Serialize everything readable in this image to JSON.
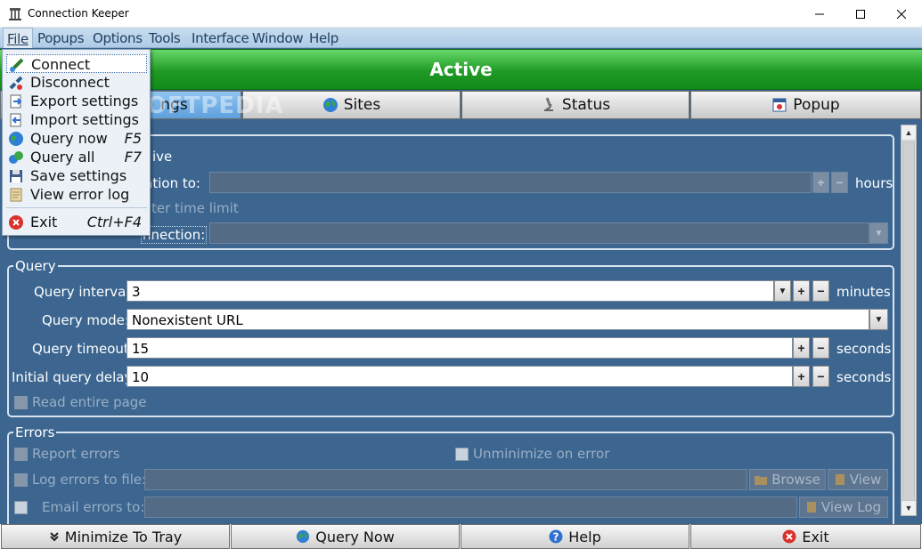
{
  "window": {
    "title": "Connection Keeper",
    "controls": {
      "minimize": "minimize",
      "maximize": "maximize",
      "close": "close"
    }
  },
  "menubar": [
    {
      "label": "File"
    },
    {
      "label": "Popups"
    },
    {
      "label": "Options"
    },
    {
      "label": "Tools"
    },
    {
      "label": "Interface"
    },
    {
      "label": "Window"
    },
    {
      "label": "Help"
    }
  ],
  "status_banner": {
    "text": "Active",
    "color": "#1f9a25"
  },
  "tabs": [
    {
      "label": "ngs",
      "icon": "gear-icon",
      "selected": true
    },
    {
      "label": "Sites",
      "icon": "globe-icon",
      "selected": false
    },
    {
      "label": "Status",
      "icon": "microscope-icon",
      "selected": false
    },
    {
      "label": "Popup",
      "icon": "calendar-icon",
      "selected": false
    }
  ],
  "watermark": "SOFTPEDIA",
  "general": {
    "line1": "ive",
    "duration_label": "ration to:",
    "duration_unit": "hours",
    "after_time_limit": "ter time limit",
    "connection_label": "nnection:"
  },
  "query": {
    "group_title": "Query",
    "interval_label": "Query interval:",
    "interval_value": "3",
    "interval_unit": "minutes",
    "mode_label": "Query mode:",
    "mode_value": "Nonexistent URL",
    "timeout_label": "Query timeout:",
    "timeout_value": "15",
    "timeout_unit": "seconds",
    "delay_label": "Initial query delay:",
    "delay_value": "10",
    "delay_unit": "seconds",
    "read_entire_page": "Read entire page"
  },
  "errors": {
    "group_title": "Errors",
    "report_errors": "Report errors",
    "unminimize_on_error": "Unminimize on error",
    "log_to_file": "Log errors to file:",
    "browse": "Browse",
    "view": "View",
    "email_errors": "Email errors to:",
    "view_log": "View Log"
  },
  "file_menu": [
    {
      "label": "Connect",
      "key": "",
      "icon": "connect-icon",
      "selected": true
    },
    {
      "label": "Disconnect",
      "key": "",
      "icon": "disconnect-icon"
    },
    {
      "label": "Export settings",
      "key": "",
      "icon": "export-icon"
    },
    {
      "label": "Import settings",
      "key": "",
      "icon": "import-icon"
    },
    {
      "label": "Query now",
      "key": "F5",
      "icon": "globe-icon"
    },
    {
      "label": "Query all",
      "key": "F7",
      "icon": "globe-multi-icon"
    },
    {
      "label": "Save settings",
      "key": "",
      "icon": "save-icon"
    },
    {
      "label": "View error log",
      "key": "",
      "icon": "log-icon"
    },
    {
      "label": "Exit",
      "key": "Ctrl+F4",
      "icon": "exit-icon"
    }
  ],
  "bottom_buttons": [
    {
      "label": "Minimize To Tray",
      "icon": "chevron-down-icon"
    },
    {
      "label": "Query Now",
      "icon": "globe-icon"
    },
    {
      "label": "Help",
      "icon": "help-icon"
    },
    {
      "label": "Exit",
      "icon": "exit-icon"
    }
  ]
}
